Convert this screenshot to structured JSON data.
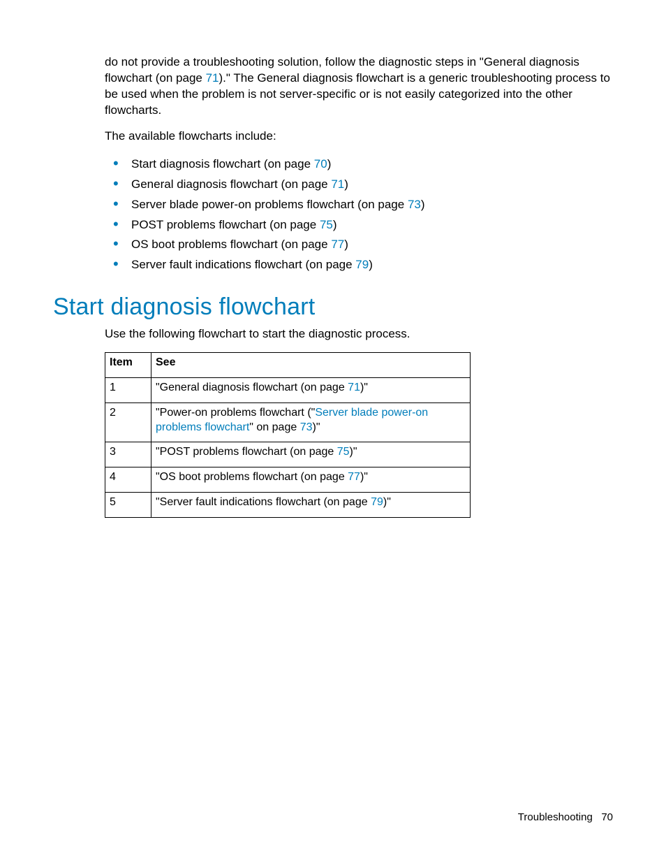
{
  "intro": {
    "p1_a": "do not provide a troubleshooting solution, follow the diagnostic steps in \"General diagnosis flowchart (on page ",
    "p1_link": "71",
    "p1_b": ").\" The General diagnosis flowchart is a generic troubleshooting process to be used when the problem is not server-specific or is not easily categorized into the other flowcharts.",
    "p2": "The available flowcharts include:"
  },
  "list": [
    {
      "pref": "Start diagnosis flowchart (on page ",
      "link": "70",
      "suf": ")"
    },
    {
      "pref": "General diagnosis flowchart (on page ",
      "link": "71",
      "suf": ")"
    },
    {
      "pref": "Server blade power-on problems flowchart (on page ",
      "link": "73",
      "suf": ")"
    },
    {
      "pref": "POST problems flowchart (on page ",
      "link": "75",
      "suf": ")"
    },
    {
      "pref": "OS boot problems flowchart (on page ",
      "link": "77",
      "suf": ")"
    },
    {
      "pref": "Server fault indications flowchart (on page ",
      "link": "79",
      "suf": ")"
    }
  ],
  "heading": "Start diagnosis flowchart",
  "subhead": "Use the following flowchart to start the diagnostic process.",
  "table": {
    "headers": {
      "item": "Item",
      "see": "See"
    },
    "rows": [
      {
        "item": "1",
        "pref": "\"General diagnosis flowchart (on page ",
        "link": "71",
        "suf": ")\""
      },
      {
        "item": "2",
        "pref": "\"Power-on problems flowchart (\"",
        "link": "Server blade power-on problems flowchart",
        "mid": "\" on page ",
        "link2": "73",
        "suf": ")\""
      },
      {
        "item": "3",
        "pref": "\"POST problems flowchart (on page ",
        "link": "75",
        "suf": ")\""
      },
      {
        "item": "4",
        "pref": "\"OS boot problems flowchart (on page ",
        "link": "77",
        "suf": ")\""
      },
      {
        "item": "5",
        "pref": "\"Server fault indications flowchart (on page ",
        "link": "79",
        "suf": ")\""
      }
    ]
  },
  "footer": {
    "section": "Troubleshooting",
    "page": "70"
  }
}
